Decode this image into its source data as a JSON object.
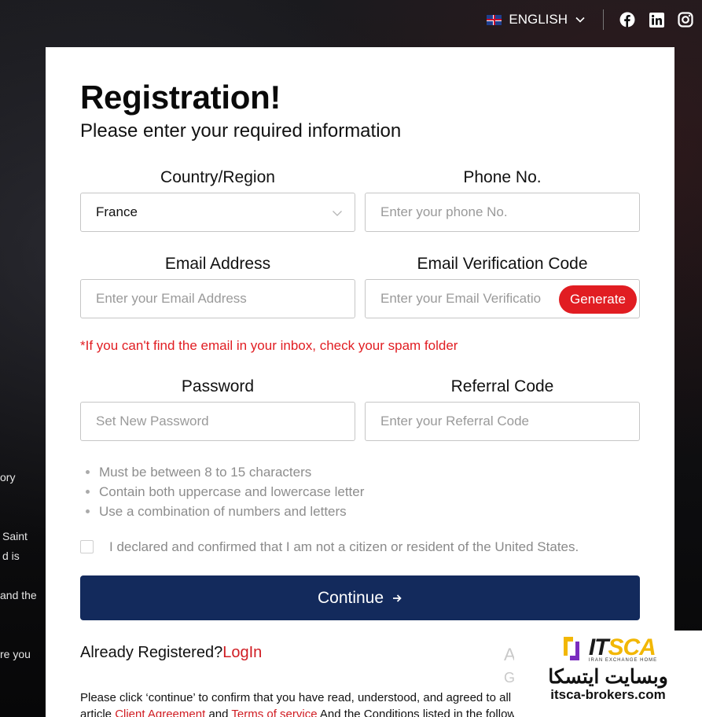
{
  "background": {
    "snippets": [
      "ory",
      "Saint",
      "d is",
      "and the",
      "re you"
    ]
  },
  "topbar": {
    "language": "ENGLISH",
    "social": [
      "facebook-icon",
      "linkedin-icon",
      "instagram-icon"
    ]
  },
  "form": {
    "title": "Registration!",
    "subtitle": "Please enter your required information",
    "country_label": "Country/Region",
    "country_value": "France",
    "phone_label": "Phone No.",
    "phone_placeholder": "Enter your phone No.",
    "email_label": "Email Address",
    "email_placeholder": "Enter your Email Address",
    "code_label": "Email Verification Code",
    "code_placeholder": "Enter your Email Verification Code",
    "generate_label": "Generate",
    "spam_note": "*If you can't find the email in your inbox, check your spam folder",
    "password_label": "Password",
    "password_placeholder": "Set New Password",
    "referral_label": "Referral Code",
    "referral_placeholder": "Enter your Referral Code",
    "password_rules": [
      "Must be between 8 to 15 characters",
      "Contain both uppercase and lowercase letter",
      "Use a combination of numbers and letters"
    ],
    "us_declaration": "I declared and confirmed that I am not a citizen or resident of the United States.",
    "continue_label": "Continue",
    "already_text": "Already Registered?",
    "login_label": "LogIn",
    "faded_a": "A",
    "faded_g": "G",
    "agree_text": "Please click ‘continue’ to confirm that you have read, understood, and agreed to all",
    "agree_prefix": "article",
    "client_agreement": "Client Agreement",
    "and_word": "and",
    "terms_of_service": "Terms of service",
    "agree_suffix": "And the Conditions listed in the follow"
  },
  "watermark": {
    "brand_a": "IT",
    "brand_b": "SCA",
    "tagline": "IRAN EXCHANGE HOME",
    "persian": "وبسایت ایتسکا",
    "url": "itsca-brokers.com"
  },
  "colors": {
    "accent_red": "#e11d22",
    "navy": "#132a5c"
  }
}
